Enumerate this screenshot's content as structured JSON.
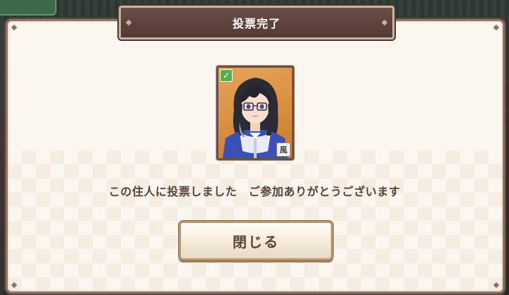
{
  "dialog": {
    "title": "投票完了",
    "message": "この住人に投票しました　ご参加ありがとうございます",
    "close_button_label": "閉じる"
  },
  "character_card": {
    "check_icon": "check-icon",
    "check_glyph": "✓",
    "element_icon": "wind-element-icon",
    "element_glyph": "風"
  },
  "colors": {
    "banner": "#5e443e",
    "panel": "#fbf6ef",
    "text": "#5a4038",
    "check": "#55b04a"
  }
}
